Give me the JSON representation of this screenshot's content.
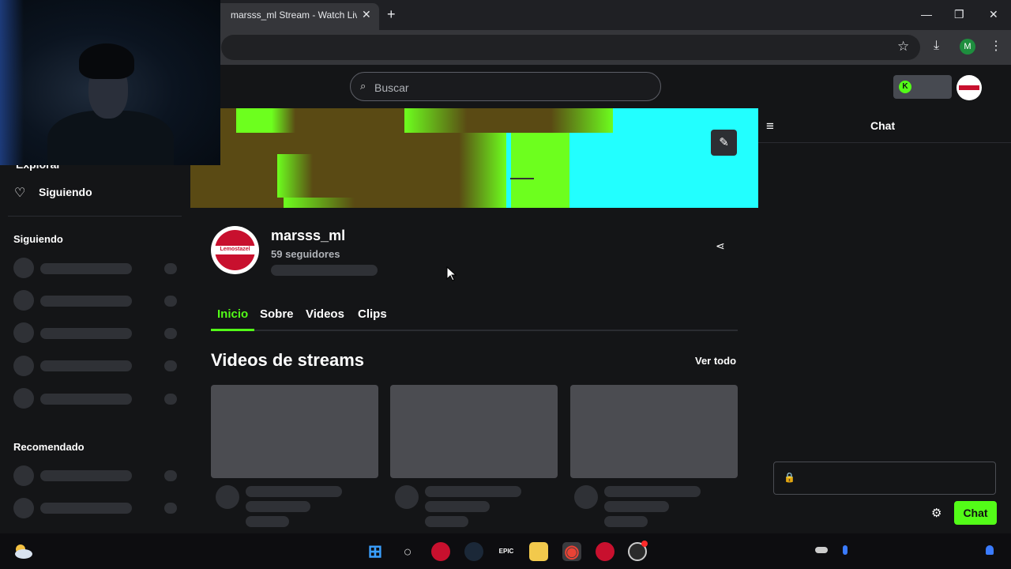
{
  "browser": {
    "tab_title": "marsss_ml Stream - Watch Live",
    "close_glyph": "✕",
    "new_tab_glyph": "+",
    "minimize_glyph": "—",
    "restore_glyph": "❐",
    "window_close_glyph": "✕",
    "star_glyph": "☆",
    "download_glyph": "⤓",
    "profile_initial": "M",
    "menu_glyph": "⋮"
  },
  "header": {
    "search_placeholder": "Buscar",
    "search_glyph": "⌕",
    "toggle_glyph": "K"
  },
  "sidebar": {
    "explore_label": "Explorar",
    "following_glyph": "♡",
    "following_label": "Siguiendo",
    "section_following": "Siguiendo",
    "section_recommended": "Recomendado"
  },
  "banner": {
    "edit_glyph": "✎"
  },
  "channel": {
    "avatar_text": "Lemostazel",
    "name": "marsss_ml",
    "followers": "59 seguidores",
    "share_glyph": "⋖"
  },
  "tabs": [
    "Inicio",
    "Sobre",
    "Videos",
    "Clips"
  ],
  "videos": {
    "title": "Videos de streams",
    "see_all": "Ver todo"
  },
  "chat": {
    "collapse_glyph": "≡",
    "title": "Chat",
    "lock_glyph": "🔒",
    "gear_glyph": "⚙",
    "send_label": "Chat"
  },
  "taskbar": {
    "start_glyph": "⊞",
    "search_glyph": "○",
    "epic_label": "EPIC",
    "chrome_glyph": "◉"
  },
  "colors": {
    "accent": "#53fc18",
    "background": "#141517",
    "skeleton": "#2f3136",
    "card": "#4b4c51"
  }
}
